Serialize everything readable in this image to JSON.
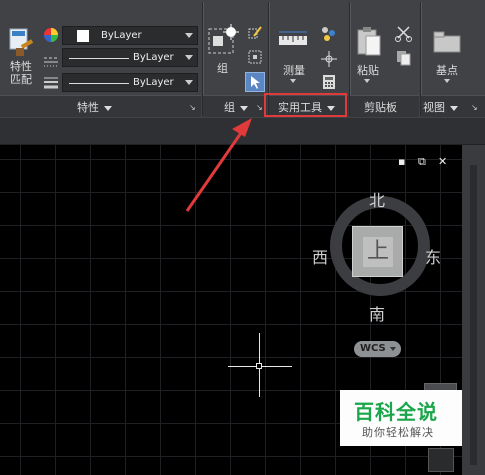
{
  "ribbon": {
    "properties_panel": {
      "match_properties_label": "特性\n匹配",
      "match_line1": "特性",
      "match_line2": "匹配",
      "color_combo": "ByLayer",
      "linetype_combo": "ByLayer",
      "lineweight_combo": "ByLayer",
      "panel_title": "特性"
    },
    "group_panel": {
      "group_label": "组",
      "panel_title": "组"
    },
    "utilities_panel": {
      "measure_label": "测量",
      "panel_title": "实用工具"
    },
    "clipboard_panel": {
      "paste_label": "粘贴",
      "panel_title": "剪贴板"
    },
    "view_panel": {
      "basepoint_label": "基点",
      "panel_title": "视图"
    }
  },
  "viewport": {
    "controls": {
      "minimize": "▪",
      "restore": "⧉",
      "close": "✕"
    },
    "viewcube": {
      "north": "北",
      "south": "南",
      "west": "西",
      "east": "东",
      "face": "上"
    },
    "wcs_label": "WCS"
  },
  "watermark": {
    "title": "百科全说",
    "subtitle": "助你轻松解决"
  },
  "colors": {
    "highlight": "#e03a3a",
    "arrow": "#e03a3a",
    "ribbon": "#404245",
    "watermark_green": "#1aa64a"
  }
}
